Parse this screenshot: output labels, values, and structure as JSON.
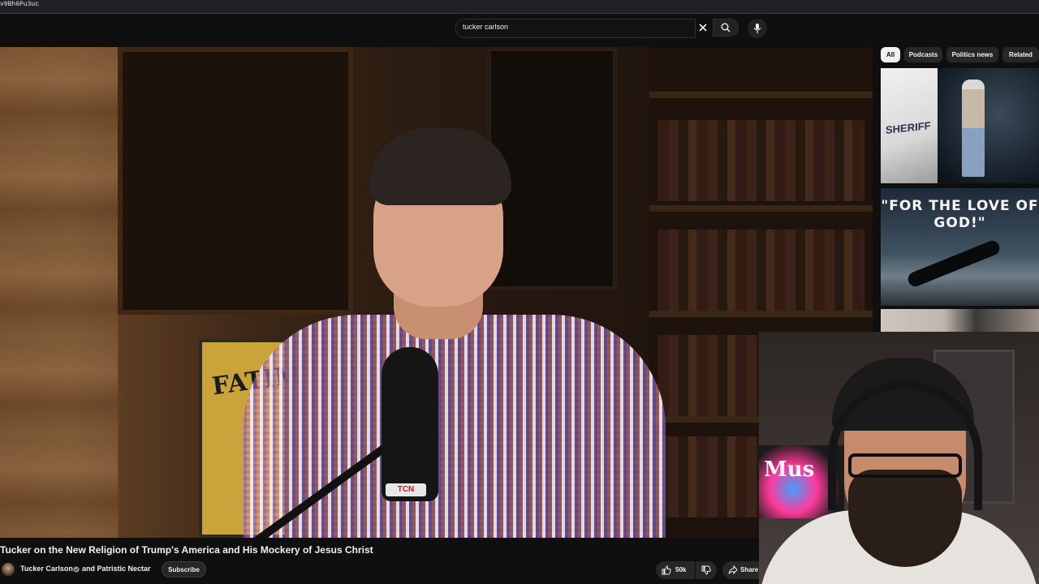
{
  "browser": {
    "url_fragment": "v9Bh6Pu3uc"
  },
  "search": {
    "query": "tucker carlson"
  },
  "chips": [
    {
      "label": "All",
      "active": true
    },
    {
      "label": "Podcasts",
      "active": false
    },
    {
      "label": "Politics news",
      "active": false
    },
    {
      "label": "Related",
      "active": false
    }
  ],
  "video": {
    "title": "Tucker on the New Religion of Trump's America and His Mockery of Jesus Christ",
    "poster_text": "FATIM",
    "mic_logo": "TCN"
  },
  "related": {
    "thumb1_text": "SHERIFF",
    "thumb2_text": "\"FOR THE LOVE OF GOD!\""
  },
  "webcam": {
    "neon_text": "Mus"
  },
  "owner": {
    "channel": "Tucker Carlson",
    "collab": "and Patristic Nectar",
    "subscribe_label": "Subscribe"
  },
  "actions": {
    "like_count": "50k",
    "share_label": "Share"
  },
  "colors": {
    "background": "#0f0f0f",
    "chip_active": "#f1f1f1",
    "chip": "#272727"
  }
}
